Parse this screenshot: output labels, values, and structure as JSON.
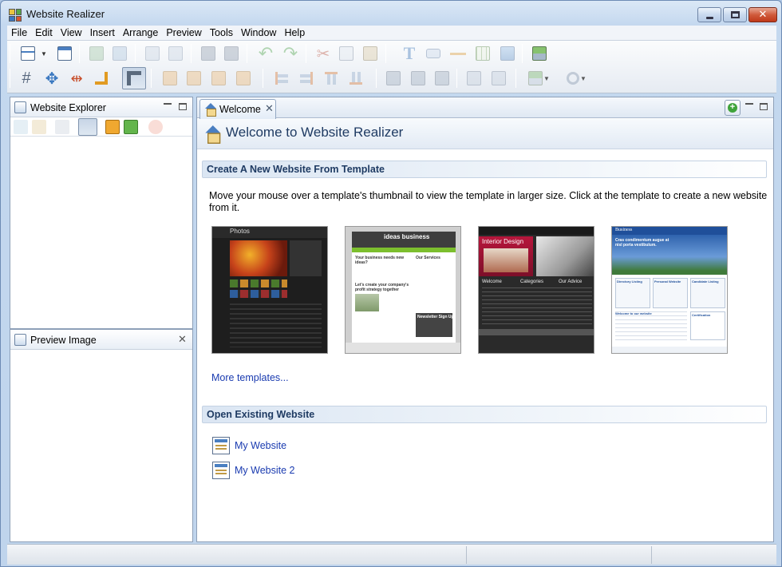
{
  "window": {
    "title": "Website Realizer"
  },
  "menu": [
    "File",
    "Edit",
    "View",
    "Insert",
    "Arrange",
    "Preview",
    "Tools",
    "Window",
    "Help"
  ],
  "toolbar": {
    "row1_icons": [
      "new-website-icon",
      "site-properties-icon",
      "export-icon",
      "publish-icon",
      "preview-page-icon",
      "preview-site-icon",
      "save-icon",
      "save-all-icon",
      "undo-icon",
      "redo-icon",
      "cut-icon",
      "copy-icon",
      "paste-icon",
      "text-icon",
      "button-icon",
      "line-icon",
      "table-icon",
      "image-icon",
      "layers-icon"
    ],
    "row2_icons": [
      "grid-icon",
      "move-icon",
      "resize-icon",
      "corner-icon",
      "ruler-icon",
      "bring-front-icon",
      "send-back-icon",
      "group-icon",
      "ungroup-icon",
      "align-left-icon",
      "align-right-icon",
      "align-top-icon",
      "align-bottom-icon",
      "same-width-icon",
      "same-height-icon",
      "same-size-icon",
      "copy-format-icon",
      "paste-format-icon",
      "upload-icon",
      "zoom-icon"
    ]
  },
  "explorer": {
    "title": "Website Explorer"
  },
  "preview": {
    "title": "Preview Image"
  },
  "tab": {
    "label": "Welcome"
  },
  "welcome": {
    "heading": "Welcome to Website Realizer",
    "section_new": "Create A New Website From Template",
    "description": "Move your mouse over a template's thumbnail to view the template in larger size. Click at the template to create a new website from it.",
    "templates": [
      {
        "name": "Photos",
        "caption": "Photos"
      },
      {
        "name": "Ideas business",
        "caption": "ideas business"
      },
      {
        "name": "Interior Design",
        "caption": "Interior Design"
      },
      {
        "name": "Business",
        "caption": "Business"
      }
    ],
    "template_text": {
      "ideas_h": "Your business needs new ideas?",
      "ideas_side": "Our Services",
      "ideas_sub": "Let's create your company's profit strategy together",
      "ideas_news": "Newsletter Sign Up",
      "interior_cols": [
        "Welcome",
        "Categories",
        "Our Advice"
      ],
      "business_head": "Cras condimentum augue at nisl porta vestibulum.",
      "business_boxes": [
        "Directory Listing",
        "Personal Website",
        "Candidate Listing"
      ],
      "business_foot": [
        "Welcome to our website",
        "Certification"
      ]
    },
    "more_templates": "More templates...",
    "section_open": "Open Existing Website",
    "recent": [
      "My Website",
      "My Website 2"
    ]
  },
  "colors": {
    "accent": "#1f3b63",
    "link": "#1a3bb0"
  }
}
